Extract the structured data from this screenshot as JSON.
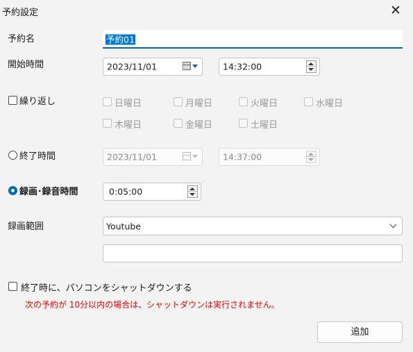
{
  "window": {
    "title": "予約設定",
    "close_glyph": "✕"
  },
  "reservation_name": {
    "label": "予約名",
    "value": "予約01"
  },
  "start_time": {
    "label": "開始時間",
    "date": "2023/11/01",
    "time": "14:32:00"
  },
  "repeat": {
    "label": "繰り返し",
    "checked": false,
    "days": [
      "日曜日",
      "月曜日",
      "火曜日",
      "水曜日",
      "木曜日",
      "金曜日",
      "土曜日"
    ]
  },
  "end_time": {
    "label": "終了時間",
    "selected": false,
    "date": "2023/11/01",
    "time": "14:37:00"
  },
  "duration": {
    "label": "録画･録音時間",
    "selected": true,
    "value": "0:05:00"
  },
  "record_range": {
    "label": "録画範囲",
    "value": "Youtube",
    "extra_value": ""
  },
  "shutdown": {
    "label": "終了時に、パソコンをシャットダウンする",
    "checked": false,
    "warning": "次の予約が 10分以内の場合は、シャットダウンは実行されません。",
    "warning_color": "#ff0000"
  },
  "buttons": {
    "add": "追加"
  },
  "colors": {
    "accent": "#0067c0"
  },
  "icons": [
    "close-icon",
    "calendar-icon",
    "spin-icon",
    "chevron-down-icon"
  ]
}
